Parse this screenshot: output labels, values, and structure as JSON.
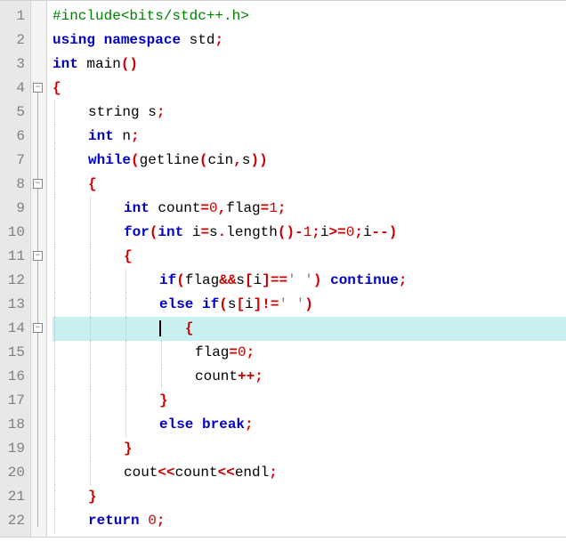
{
  "editor": {
    "line_count": 22,
    "highlighted_line": 14,
    "fold_markers": [
      {
        "line": 4,
        "state": "open"
      },
      {
        "line": 8,
        "state": "open"
      },
      {
        "line": 11,
        "state": "open"
      },
      {
        "line": 14,
        "state": "open"
      }
    ],
    "lines": {
      "l1": {
        "indent": 0,
        "tokens": [
          {
            "t": "#include<bits/stdc++.h>",
            "c": "pp"
          }
        ]
      },
      "l2": {
        "indent": 0,
        "tokens": [
          {
            "t": "using",
            "c": "kw"
          },
          {
            "t": " ",
            "c": "plain"
          },
          {
            "t": "namespace",
            "c": "kw"
          },
          {
            "t": " std",
            "c": "plain"
          },
          {
            "t": ";",
            "c": "op"
          }
        ]
      },
      "l3": {
        "indent": 0,
        "tokens": [
          {
            "t": "int",
            "c": "kw"
          },
          {
            "t": " main",
            "c": "plain"
          },
          {
            "t": "()",
            "c": "op"
          }
        ]
      },
      "l4": {
        "indent": 0,
        "tokens": [
          {
            "t": "{",
            "c": "op"
          }
        ]
      },
      "l5": {
        "indent": 1,
        "tokens": [
          {
            "t": "string s",
            "c": "plain"
          },
          {
            "t": ";",
            "c": "op"
          }
        ]
      },
      "l6": {
        "indent": 1,
        "tokens": [
          {
            "t": "int",
            "c": "kw"
          },
          {
            "t": " n",
            "c": "plain"
          },
          {
            "t": ";",
            "c": "op"
          }
        ]
      },
      "l7": {
        "indent": 1,
        "tokens": [
          {
            "t": "while",
            "c": "kw"
          },
          {
            "t": "(",
            "c": "op"
          },
          {
            "t": "getline",
            "c": "plain"
          },
          {
            "t": "(",
            "c": "op"
          },
          {
            "t": "cin",
            "c": "plain"
          },
          {
            "t": ",",
            "c": "op"
          },
          {
            "t": "s",
            "c": "plain"
          },
          {
            "t": "))",
            "c": "op"
          }
        ]
      },
      "l8": {
        "indent": 1,
        "tokens": [
          {
            "t": "{",
            "c": "op"
          }
        ]
      },
      "l9": {
        "indent": 2,
        "tokens": [
          {
            "t": "int",
            "c": "kw"
          },
          {
            "t": " count",
            "c": "plain"
          },
          {
            "t": "=",
            "c": "op"
          },
          {
            "t": "0",
            "c": "num"
          },
          {
            "t": ",",
            "c": "op"
          },
          {
            "t": "flag",
            "c": "plain"
          },
          {
            "t": "=",
            "c": "op"
          },
          {
            "t": "1",
            "c": "num"
          },
          {
            "t": ";",
            "c": "op"
          }
        ]
      },
      "l10": {
        "indent": 2,
        "tokens": [
          {
            "t": "for",
            "c": "kw"
          },
          {
            "t": "(",
            "c": "op"
          },
          {
            "t": "int",
            "c": "kw"
          },
          {
            "t": " i",
            "c": "plain"
          },
          {
            "t": "=",
            "c": "op"
          },
          {
            "t": "s",
            "c": "plain"
          },
          {
            "t": ".",
            "c": "op"
          },
          {
            "t": "length",
            "c": "plain"
          },
          {
            "t": "()-",
            "c": "op"
          },
          {
            "t": "1",
            "c": "num"
          },
          {
            "t": ";",
            "c": "op"
          },
          {
            "t": "i",
            "c": "plain"
          },
          {
            "t": ">=",
            "c": "op"
          },
          {
            "t": "0",
            "c": "num"
          },
          {
            "t": ";",
            "c": "op"
          },
          {
            "t": "i",
            "c": "plain"
          },
          {
            "t": "--)",
            "c": "op"
          }
        ]
      },
      "l11": {
        "indent": 2,
        "tokens": [
          {
            "t": "{",
            "c": "op"
          }
        ]
      },
      "l12": {
        "indent": 3,
        "tokens": [
          {
            "t": "if",
            "c": "kw"
          },
          {
            "t": "(",
            "c": "op"
          },
          {
            "t": "flag",
            "c": "plain"
          },
          {
            "t": "&&",
            "c": "op"
          },
          {
            "t": "s",
            "c": "plain"
          },
          {
            "t": "[",
            "c": "op"
          },
          {
            "t": "i",
            "c": "plain"
          },
          {
            "t": "]==",
            "c": "op"
          },
          {
            "t": "' '",
            "c": "str"
          },
          {
            "t": ")",
            "c": "op"
          },
          {
            "t": " ",
            "c": "plain"
          },
          {
            "t": "continue",
            "c": "kw"
          },
          {
            "t": ";",
            "c": "op"
          }
        ]
      },
      "l13": {
        "indent": 3,
        "tokens": [
          {
            "t": "else",
            "c": "kw"
          },
          {
            "t": " ",
            "c": "plain"
          },
          {
            "t": "if",
            "c": "kw"
          },
          {
            "t": "(",
            "c": "op"
          },
          {
            "t": "s",
            "c": "plain"
          },
          {
            "t": "[",
            "c": "op"
          },
          {
            "t": "i",
            "c": "plain"
          },
          {
            "t": "]!=",
            "c": "op"
          },
          {
            "t": "' '",
            "c": "str"
          },
          {
            "t": ")",
            "c": "op"
          }
        ]
      },
      "l14": {
        "indent": 3,
        "caret": true,
        "tokens": [
          {
            "t": "{",
            "c": "op"
          }
        ]
      },
      "l15": {
        "indent": 4,
        "tokens": [
          {
            "t": "flag",
            "c": "plain"
          },
          {
            "t": "=",
            "c": "op"
          },
          {
            "t": "0",
            "c": "num"
          },
          {
            "t": ";",
            "c": "op"
          }
        ]
      },
      "l16": {
        "indent": 4,
        "tokens": [
          {
            "t": "count",
            "c": "plain"
          },
          {
            "t": "++;",
            "c": "op"
          }
        ]
      },
      "l17": {
        "indent": 3,
        "tokens": [
          {
            "t": "}",
            "c": "op"
          }
        ]
      },
      "l18": {
        "indent": 3,
        "tokens": [
          {
            "t": "else",
            "c": "kw"
          },
          {
            "t": " ",
            "c": "plain"
          },
          {
            "t": "break",
            "c": "kw"
          },
          {
            "t": ";",
            "c": "op"
          }
        ]
      },
      "l19": {
        "indent": 2,
        "tokens": [
          {
            "t": "}",
            "c": "op"
          }
        ]
      },
      "l20": {
        "indent": 2,
        "tokens": [
          {
            "t": "cout",
            "c": "plain"
          },
          {
            "t": "<<",
            "c": "op"
          },
          {
            "t": "count",
            "c": "plain"
          },
          {
            "t": "<<",
            "c": "op"
          },
          {
            "t": "endl",
            "c": "plain"
          },
          {
            "t": ";",
            "c": "op"
          }
        ]
      },
      "l21": {
        "indent": 1,
        "tokens": [
          {
            "t": "}",
            "c": "op"
          }
        ]
      },
      "l22": {
        "indent": 1,
        "tokens": [
          {
            "t": "return",
            "c": "kw"
          },
          {
            "t": " ",
            "c": "plain"
          },
          {
            "t": "0",
            "c": "num"
          },
          {
            "t": ";",
            "c": "op"
          }
        ]
      }
    }
  }
}
